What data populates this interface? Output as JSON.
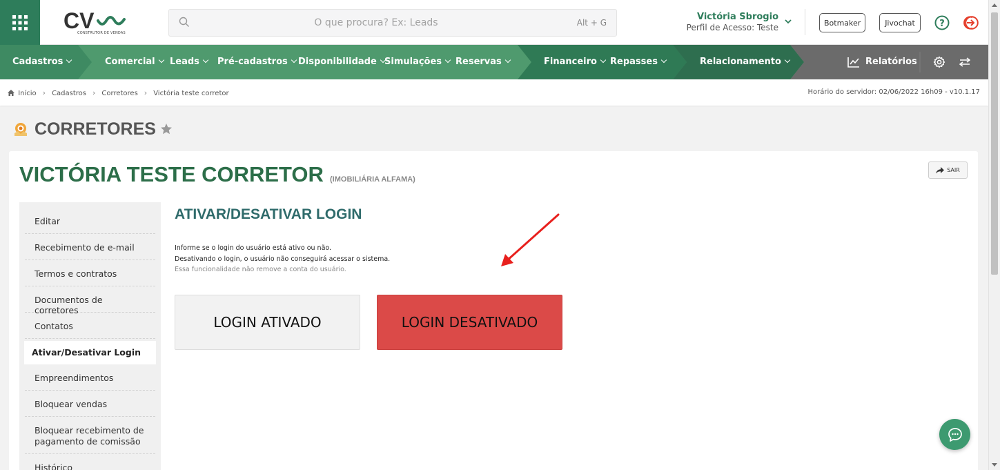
{
  "header": {
    "search_placeholder": "O que procura? Ex: Leads",
    "search_shortcut": "Alt + G",
    "logo_text": "CV",
    "logo_subtitle": "CONSTRUTOR DE VENDAS",
    "user_name": "Victória Sbrogio",
    "user_profile": "Perfil de Acesso: Teste",
    "botmaker_label": "Botmaker",
    "jivochat_label": "Jivochat"
  },
  "nav": {
    "cadastros": "Cadastros",
    "comercial": "Comercial",
    "leads": "Leads",
    "pre_cadastros": "Pré-cadastros",
    "disponibilidade": "Disponibilidade",
    "simulacoes": "Simulações",
    "reservas": "Reservas",
    "financeiro": "Financeiro",
    "repasses": "Repasses",
    "relacionamento": "Relacionamento",
    "relatorios": "Relatórios"
  },
  "breadcrumb": {
    "items": [
      "Início",
      "Cadastros",
      "Corretores",
      "Victória teste corretor"
    ],
    "server_time": "Horário do servidor: 02/06/2022 16h09 - v10.1.17"
  },
  "page": {
    "title": "CORRETORES",
    "entity_name": "VICTÓRIA TESTE CORRETOR",
    "entity_org": "(IMOBILIÁRIA ALFAMA)",
    "exit_label": "SAIR"
  },
  "sidemenu": {
    "items": [
      {
        "label": "Editar"
      },
      {
        "label": "Recebimento de e-mail"
      },
      {
        "label": "Termos e contratos"
      },
      {
        "label": "Documentos de corretores"
      },
      {
        "label": "Contatos"
      },
      {
        "label": "Ativar/Desativar Login"
      },
      {
        "label": "Empreendimentos"
      },
      {
        "label": "Bloquear vendas"
      },
      {
        "label": "Bloquear recebimento de pagamento de comissão"
      },
      {
        "label": "Histórico"
      }
    ],
    "active_index": 5
  },
  "content": {
    "section_title": "ATIVAR/DESATIVAR LOGIN",
    "info_line1": "Informe se o login do usuário está ativo ou não.",
    "info_line2": "Desativando o login, o usuário não conseguirá acessar o sistema.",
    "info_line3": "Essa funcionalidade não remove a conta do usuário.",
    "btn_enabled": "LOGIN ATIVADO",
    "btn_disabled": "LOGIN DESATIVADO"
  },
  "colors": {
    "brand_green": "#2e7d5b",
    "nav_green": "#4f9a6e",
    "nav_dark": "#2e6e4f",
    "nav_gray": "#6b6b6b",
    "title_green": "#2c6e49",
    "danger_red": "#db4a48",
    "annotation_red": "#e8201d"
  }
}
